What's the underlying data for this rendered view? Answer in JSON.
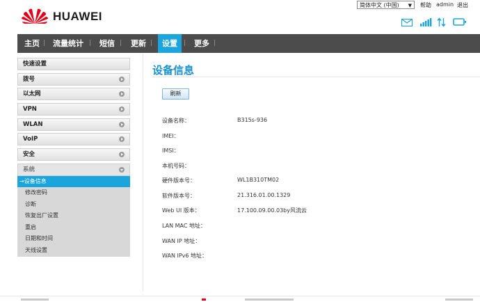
{
  "header": {
    "brand": "HUAWEI",
    "brand_color": "#e2001a",
    "language": "简体中文 (中国)",
    "help": "帮助",
    "user": "admin",
    "logout": "退出",
    "status_icons": [
      "mail-icon",
      "signal-icon",
      "data-transfer-icon",
      "display-icon"
    ]
  },
  "nav": {
    "items": [
      "主页",
      "流量统计",
      "短信",
      "更新",
      "设置",
      "更多"
    ],
    "active": "设置",
    "accent": "#1aa5dd"
  },
  "sidebar": {
    "items": [
      "快速设置",
      "拨号",
      "以太网",
      "VPN",
      "WLAN",
      "VoIP",
      "安全",
      "系统"
    ],
    "expanded": "系统",
    "sub_items": [
      "→设备信息",
      "修改密码",
      "诊断",
      "恢复出厂设置",
      "重启",
      "日期和时间",
      "天线设置"
    ],
    "active_sub": "→设备信息"
  },
  "main": {
    "title": "设备信息",
    "refresh_label": "刷新",
    "rows": [
      {
        "label": "设备名称：",
        "value": "B315s-936"
      },
      {
        "label": "IMEI：",
        "value": ""
      },
      {
        "label": "IMSI：",
        "value": ""
      },
      {
        "label": "本机号码：",
        "value": ""
      },
      {
        "label": "硬件版本号：",
        "value": "WL1B310TM02"
      },
      {
        "label": "软件版本号：",
        "value": "21.316.01.00.1329"
      },
      {
        "label": "Web UI 版本：",
        "value": "17.100.09.00.03by风流云"
      },
      {
        "label": "LAN MAC 地址：",
        "value": ""
      },
      {
        "label": "WAN IP 地址：",
        "value": ""
      },
      {
        "label": "WAN IPv6 地址：",
        "value": ""
      }
    ]
  }
}
